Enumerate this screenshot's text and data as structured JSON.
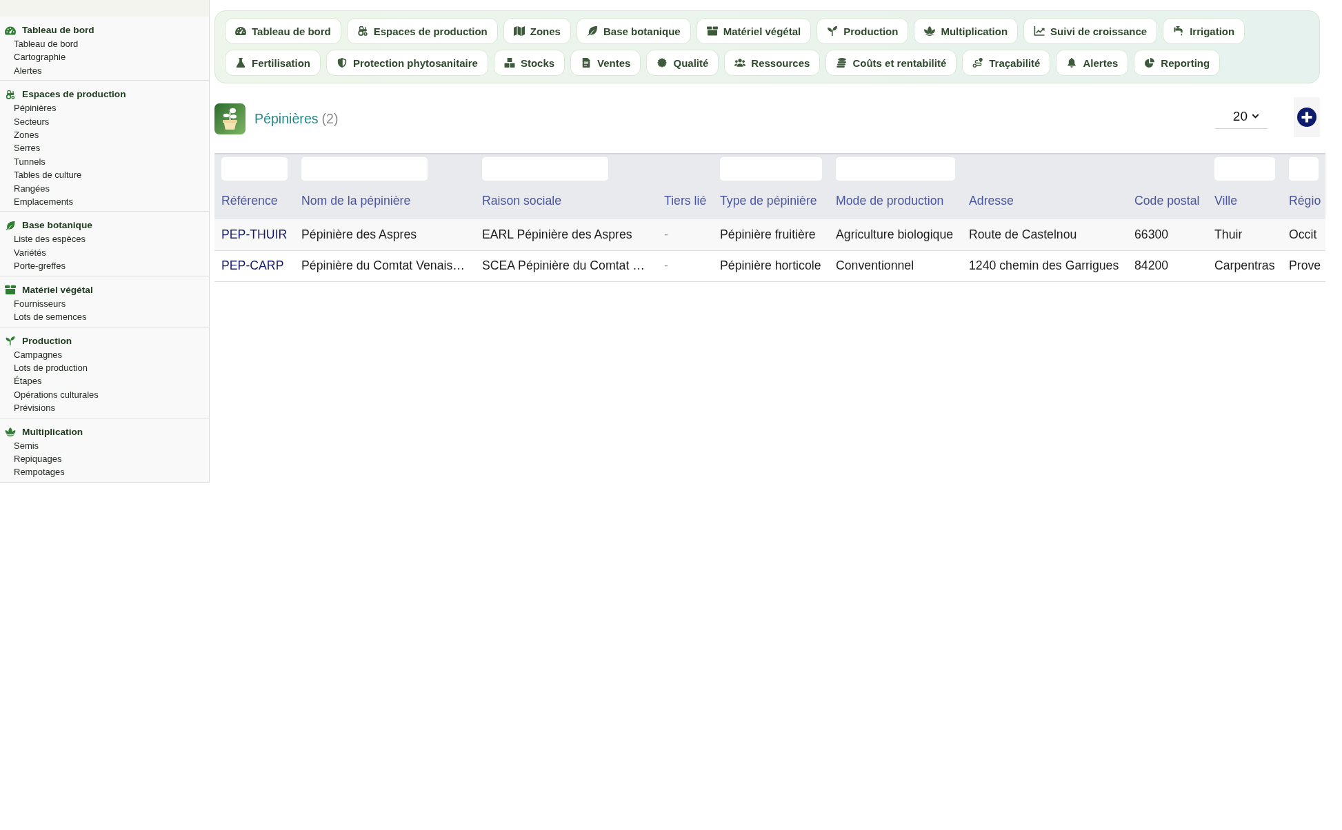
{
  "sidebar": {
    "sections": [
      {
        "title": "Tableau de bord",
        "items": [
          "Tableau de bord",
          "Cartographie",
          "Alertes"
        ]
      },
      {
        "title": "Espaces de production",
        "items": [
          "Pépinières",
          "Secteurs",
          "Zones",
          "Serres",
          "Tunnels",
          "Tables de culture",
          "Rangées",
          "Emplacements"
        ]
      },
      {
        "title": "Base botanique",
        "items": [
          "Liste des espèces",
          "Variétés",
          "Porte-greffes"
        ]
      },
      {
        "title": "Matériel végétal",
        "items": [
          "Fournisseurs",
          "Lots de semences"
        ]
      },
      {
        "title": "Production",
        "items": [
          "Campagnes",
          "Lots de production",
          "Étapes",
          "Opérations culturales",
          "Prévisions"
        ]
      },
      {
        "title": "Multiplication",
        "items": [
          "Semis",
          "Repiquages",
          "Rempotages"
        ]
      }
    ]
  },
  "nav": {
    "items": [
      "Tableau de bord",
      "Espaces de production",
      "Zones",
      "Base botanique",
      "Matériel végétal",
      "Production",
      "Multiplication",
      "Suivi de croissance",
      "Irrigation",
      "Fertilisation",
      "Protection phytosanitaire",
      "Stocks",
      "Ventes",
      "Qualité",
      "Ressources",
      "Coûts et rentabilité",
      "Traçabilité",
      "Alertes",
      "Reporting"
    ]
  },
  "page_header": {
    "title": "Pépinières",
    "count": "(2)",
    "page_size": "20"
  },
  "table": {
    "columns": [
      {
        "label": "Référence",
        "filter": true,
        "kind": "link"
      },
      {
        "label": "Nom de la pépinière",
        "filter": true,
        "kind": "text"
      },
      {
        "label": "Raison sociale",
        "filter": true,
        "kind": "text"
      },
      {
        "label": "Tiers lié",
        "filter": false,
        "kind": "muted"
      },
      {
        "label": "Type de pépinière",
        "filter": true,
        "kind": "text"
      },
      {
        "label": "Mode de production",
        "filter": true,
        "kind": "text"
      },
      {
        "label": "Adresse",
        "filter": false,
        "kind": "text"
      },
      {
        "label": "Code postal",
        "filter": false,
        "kind": "text"
      },
      {
        "label": "Ville",
        "filter": true,
        "kind": "text"
      },
      {
        "label": "Régio",
        "filter": true,
        "kind": "text"
      }
    ],
    "rows": [
      [
        "PEP-THUIR",
        "Pépinière des Aspres",
        "EARL Pépinière des Aspres",
        "-",
        "Pépinière fruitière",
        "Agriculture biologique",
        "Route de Castelnou",
        "66300",
        "Thuir",
        "Occit"
      ],
      [
        "PEP-CARP",
        "Pépinière du Comtat Venais…",
        "SCEA Pépinière du Comtat …",
        "-",
        "Pépinière horticole",
        "Conventionnel",
        "1240 chemin des Garrigues",
        "84200",
        "Carpentras",
        "Prove"
      ]
    ]
  }
}
